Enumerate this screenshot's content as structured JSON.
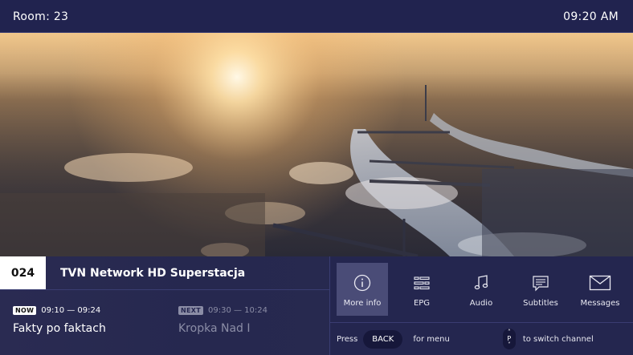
{
  "topbar": {
    "room": "Room: 23",
    "time": "09:20 AM"
  },
  "channel": {
    "number": "024",
    "name": "TVN Network HD Superstacja"
  },
  "now": {
    "badge": "NOW",
    "time": "09:10 — 09:24",
    "title": "Fakty po faktach"
  },
  "next": {
    "badge": "NEXT",
    "time": "09:30 — 10:24",
    "title": "Kropka Nad I"
  },
  "actions": [
    {
      "label": "More info",
      "icon": "info-icon"
    },
    {
      "label": "EPG",
      "icon": "epg-icon"
    },
    {
      "label": "Audio",
      "icon": "music-note-icon"
    },
    {
      "label": "Subtitles",
      "icon": "subtitles-icon"
    },
    {
      "label": "Messages",
      "icon": "envelope-icon"
    }
  ],
  "hint": {
    "press": "Press",
    "back_key": "BACK",
    "for_menu": "for menu",
    "p_key": "P",
    "switch": "to switch channel"
  },
  "colors": {
    "background": "#1d1f4a",
    "panel": "#24264f",
    "active_action": "#4a4c77",
    "key_bg": "#16173a",
    "muted_text": "#8b8da6"
  }
}
